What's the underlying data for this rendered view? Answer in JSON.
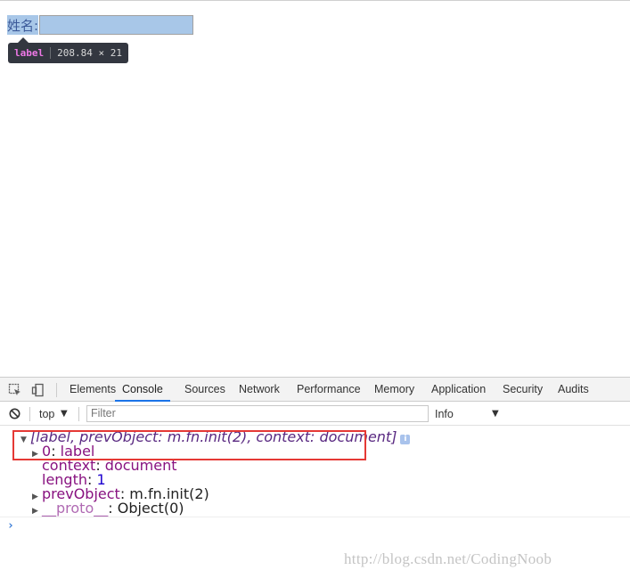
{
  "page": {
    "name_label": "姓名:",
    "name_input_value": ""
  },
  "inspect_tooltip": {
    "tag": "label",
    "size": "208.84 × 21"
  },
  "devtools": {
    "tabs": [
      {
        "label": "Elements",
        "active": false
      },
      {
        "label": "Console",
        "active": true
      },
      {
        "label": "Sources",
        "active": false
      },
      {
        "label": "Network",
        "active": false
      },
      {
        "label": "Performance",
        "active": false
      },
      {
        "label": "Memory",
        "active": false
      },
      {
        "label": "Application",
        "active": false
      },
      {
        "label": "Security",
        "active": false
      },
      {
        "label": "Audits",
        "active": false
      }
    ],
    "toolbar": {
      "context": "top",
      "filter_placeholder": "Filter",
      "level": "Info"
    },
    "console": {
      "summary": "[label, prevObject: m.fn.init(2), context: document]",
      "entries": [
        {
          "key": "0",
          "value": "label"
        },
        {
          "key": "context",
          "value": "document"
        },
        {
          "key": "length",
          "value": "1"
        },
        {
          "key": "prevObject",
          "value": "m.fn.init(2)"
        },
        {
          "key": "__proto__",
          "value": "Object(0)"
        }
      ],
      "prompt": "›"
    },
    "accent_color": "#1a73e8",
    "highlight_color": "#e53935"
  },
  "watermark": "http://blog.csdn.net/CodingNoob"
}
